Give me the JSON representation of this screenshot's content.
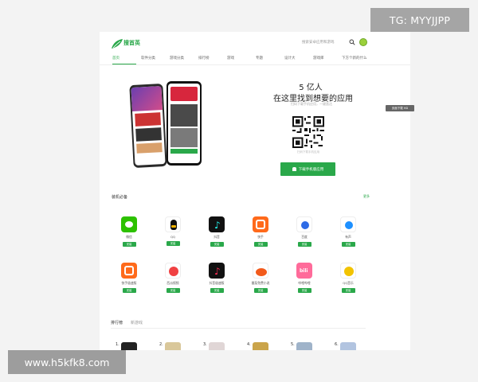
{
  "overlay": {
    "tg_label": "TG: MYYJJPP",
    "watermark": "www.h5kfk8.com"
  },
  "header": {
    "brand": "搜首英",
    "search_placeholder": "搜索安卓应用和游戏",
    "nav": [
      "首页",
      "软件分类",
      "游戏分类",
      "排行榜",
      "游戏",
      "专题",
      "设计大",
      "游戏库",
      "下方个新的什么"
    ]
  },
  "side_tip": "页面下载 HD",
  "hero": {
    "count": "5 亿人",
    "title": "在这里找到想要的应用",
    "subtitle": "扫码下载手机应用，一键直达",
    "qr_caption": "扫码下载手机应用",
    "download_label": "下载手机版应用"
  },
  "section": {
    "title": "装机必备",
    "more": "更多",
    "apps": [
      {
        "name": "微信",
        "icon": "wechat-icon",
        "get": "安装",
        "color": "#2dc100"
      },
      {
        "name": "QQ",
        "icon": "qq-icon",
        "get": "安装",
        "color": "#ffffff"
      },
      {
        "name": "抖音",
        "icon": "tiktok-icon",
        "get": "安装",
        "color": "#111111"
      },
      {
        "name": "快手",
        "icon": "kuaishou-icon",
        "get": "安装",
        "color": "#ff6a1b"
      },
      {
        "name": "百度",
        "icon": "baidu-icon",
        "get": "安装",
        "color": "#ffffff"
      },
      {
        "name": "有声",
        "icon": "music-icon",
        "get": "安装",
        "color": "#ffffff"
      },
      {
        "name": "快手极速版",
        "icon": "kuaishou-lite-icon",
        "get": "安装",
        "color": "#ff6a1b"
      },
      {
        "name": "西瓜视频",
        "icon": "xigua-icon",
        "get": "安装",
        "color": "#ffffff"
      },
      {
        "name": "抖音极速版",
        "icon": "tiktok-lite-icon",
        "get": "安装",
        "color": "#111111"
      },
      {
        "name": "番茄免费小说",
        "icon": "fanqie-icon",
        "get": "安装",
        "color": "#ffffff"
      },
      {
        "name": "哔哩哔哩",
        "icon": "bilibili-icon",
        "get": "安装",
        "color": "#ff6b9a"
      },
      {
        "name": "QQ音乐",
        "icon": "qqmusic-icon",
        "get": "安装",
        "color": "#ffffff"
      }
    ]
  },
  "ranking": {
    "tabs": [
      "排行榜",
      "新游戏"
    ],
    "items": [
      {
        "num": "1.",
        "color": "#222222"
      },
      {
        "num": "2.",
        "color": "#d9c79a"
      },
      {
        "num": "3.",
        "color": "#e0d6d6"
      },
      {
        "num": "4.",
        "color": "#caa44a"
      },
      {
        "num": "5.",
        "color": "#9fb3c9"
      },
      {
        "num": "6.",
        "color": "#b2c4e0"
      }
    ]
  },
  "colors": {
    "accent": "#2aa84a"
  }
}
